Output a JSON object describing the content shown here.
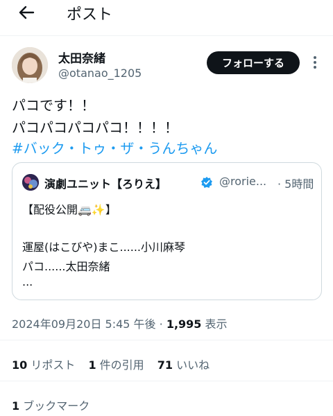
{
  "header": {
    "title": "ポスト",
    "back_icon": "arrow-left-icon"
  },
  "author": {
    "name": "太田奈緒",
    "handle": "@otanao_1205",
    "follow_label": "フォローする"
  },
  "post": {
    "line1": "パコです！！",
    "line2": "パコパコパコパコ！！！！",
    "hashtag": "#バック・トゥ・ザ・うんちゃん"
  },
  "quote": {
    "name": "演劇ユニット【ろりえ】",
    "handle": "@rorie...",
    "time": "· 5時間",
    "line1": "【配役公開🚐✨】",
    "line2": "運屋(はこびや)まこ......小川麻琴",
    "line3": "パコ......太田奈緒",
    "line4": "..."
  },
  "meta": {
    "timestamp": "2024年09月20日 5:45 午後 · ",
    "views_count": "1,995",
    "views_label": " 表示"
  },
  "stats": {
    "reposts_count": "10",
    "reposts_label": " リポスト",
    "quotes_count": "1",
    "quotes_label": " 件の引用",
    "likes_count": "71",
    "likes_label": " いいね"
  },
  "bookmarks": {
    "count": "1",
    "label": " ブックマーク"
  },
  "colors": {
    "accent": "#1d9bf0",
    "text": "#0f1419",
    "secondary": "#536471",
    "border": "#cfd9de"
  }
}
